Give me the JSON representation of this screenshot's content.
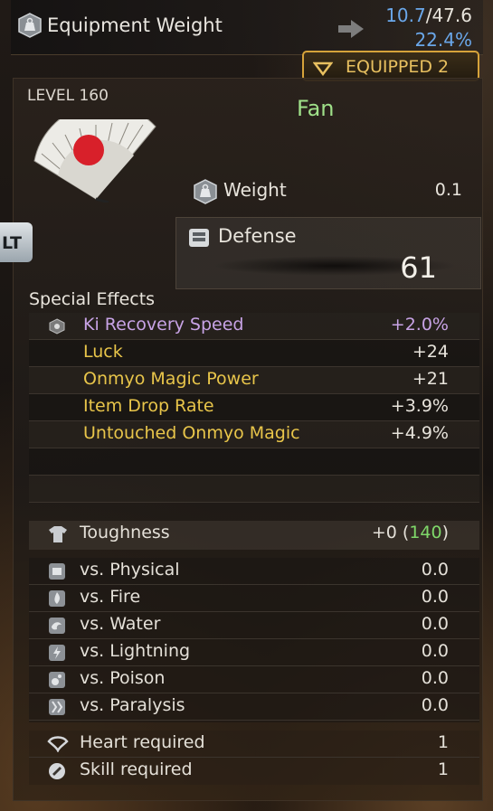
{
  "header": {
    "title": "Equipment Weight",
    "weight_current": "10.7",
    "weight_max": "/47.6",
    "weight_percent": "22.4%",
    "equipped_label": "EQUIPPED 2"
  },
  "item": {
    "level": "LEVEL 160",
    "name": "Fan",
    "weight_label": "Weight",
    "weight_value": "0.1",
    "defense_label": "Defense",
    "defense_value": "61",
    "lt_label": "LT"
  },
  "special_effects": {
    "title": "Special Effects",
    "rows": [
      {
        "label": "Ki Recovery Speed",
        "value": "+2.0%",
        "color": "#c8a3e6"
      },
      {
        "label": "Luck",
        "value": "+24",
        "color": "#e8c54a"
      },
      {
        "label": "Onmyo Magic Power",
        "value": "+21",
        "color": "#e8c54a"
      },
      {
        "label": "Item Drop Rate",
        "value": "+3.9%",
        "color": "#e8c54a"
      },
      {
        "label": "Untouched Onmyo Magic",
        "value": "+4.9%",
        "color": "#e8c54a"
      }
    ]
  },
  "toughness": {
    "label": "Toughness",
    "value_prefix": "+0 (",
    "value_total": "140",
    "value_suffix": ")"
  },
  "resistances": [
    {
      "label": "vs. Physical",
      "value": "0.0",
      "icon": "physical-icon"
    },
    {
      "label": "vs. Fire",
      "value": "0.0",
      "icon": "fire-icon"
    },
    {
      "label": "vs. Water",
      "value": "0.0",
      "icon": "water-icon"
    },
    {
      "label": "vs. Lightning",
      "value": "0.0",
      "icon": "lightning-icon"
    },
    {
      "label": "vs. Poison",
      "value": "0.0",
      "icon": "poison-icon"
    },
    {
      "label": "vs. Paralysis",
      "value": "0.0",
      "icon": "paralysis-icon"
    }
  ],
  "requirements": [
    {
      "label": "Heart required",
      "value": "1",
      "icon": "heart-req-icon"
    },
    {
      "label": "Skill required",
      "value": "1",
      "icon": "skill-req-icon"
    }
  ]
}
